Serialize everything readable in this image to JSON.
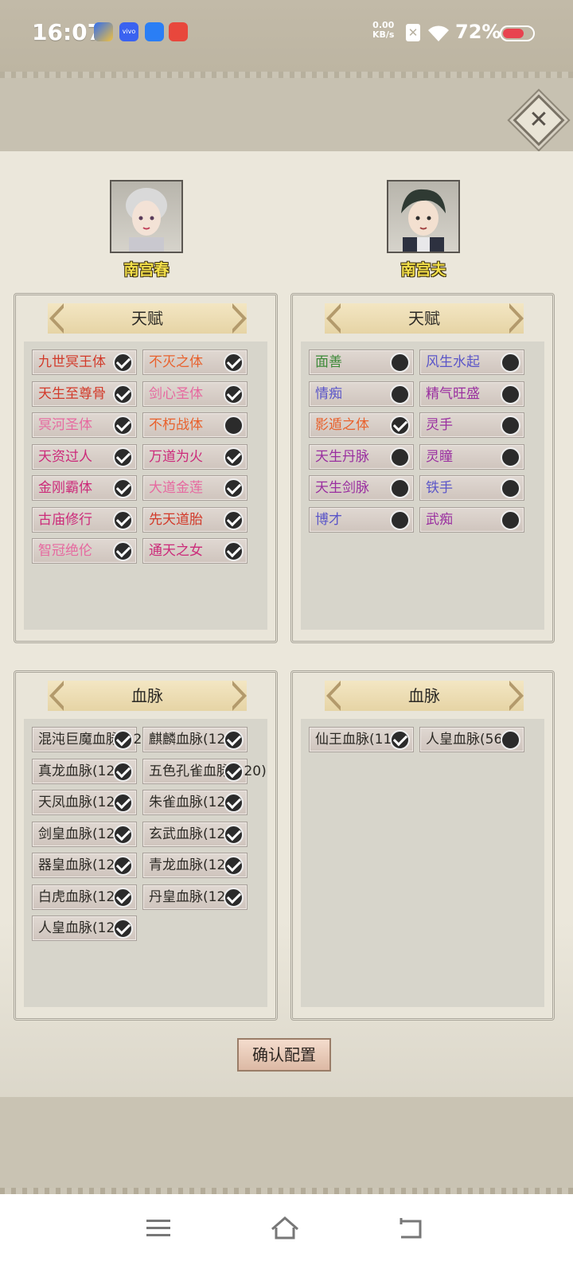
{
  "status_bar": {
    "time": "16:07",
    "net_speed": "0.00",
    "net_unit": "KB/s",
    "battery": "72%"
  },
  "close_label": "✕",
  "characters": [
    {
      "name": "南宫春"
    },
    {
      "name": "南宫夫"
    }
  ],
  "talent_title": "天赋",
  "bloodline_title": "血脉",
  "left_talents": [
    {
      "label": "九世冥王体",
      "color": "#d23a2a",
      "checked": true
    },
    {
      "label": "不灭之体",
      "color": "#e8622e",
      "checked": true
    },
    {
      "label": "天生至尊骨",
      "color": "#d23a2a",
      "checked": true
    },
    {
      "label": "剑心圣体",
      "color": "#e66aa0",
      "checked": true
    },
    {
      "label": "冥河圣体",
      "color": "#e66aa0",
      "checked": true
    },
    {
      "label": "不朽战体",
      "color": "#e8622e",
      "checked": false
    },
    {
      "label": "天资过人",
      "color": "#cc2b7a",
      "checked": true
    },
    {
      "label": "万道为火",
      "color": "#cc2b7a",
      "checked": true
    },
    {
      "label": "金刚霸体",
      "color": "#cc2b7a",
      "checked": true
    },
    {
      "label": "大道金莲",
      "color": "#e66aa0",
      "checked": true
    },
    {
      "label": "古庙修行",
      "color": "#cc2b7a",
      "checked": true
    },
    {
      "label": "先天道胎",
      "color": "#d23a2a",
      "checked": true
    },
    {
      "label": "智冠绝伦",
      "color": "#e66aa0",
      "checked": true
    },
    {
      "label": "通天之女",
      "color": "#cc2b7a",
      "checked": true
    }
  ],
  "right_talents": [
    {
      "label": "面善",
      "color": "#3f8a3a",
      "checked": false
    },
    {
      "label": "风生水起",
      "color": "#5b56c8",
      "checked": false
    },
    {
      "label": "情痴",
      "color": "#5b56c8",
      "checked": false
    },
    {
      "label": "精气旺盛",
      "color": "#9a2fa0",
      "checked": false
    },
    {
      "label": "影遁之体",
      "color": "#e8622e",
      "checked": true
    },
    {
      "label": "灵手",
      "color": "#9a2fa0",
      "checked": false
    },
    {
      "label": "天生丹脉",
      "color": "#9a2fa0",
      "checked": false
    },
    {
      "label": "灵瞳",
      "color": "#9a2fa0",
      "checked": false
    },
    {
      "label": "天生剑脉",
      "color": "#9a2fa0",
      "checked": false
    },
    {
      "label": "铁手",
      "color": "#5b56c8",
      "checked": false
    },
    {
      "label": "博才",
      "color": "#5b56c8",
      "checked": false
    },
    {
      "label": "武痴",
      "color": "#9a2fa0",
      "checked": false
    }
  ],
  "left_bloodlines": [
    {
      "label": "混沌巨魔血脉(12",
      "checked": true
    },
    {
      "label": "麒麟血脉(12",
      "checked": true
    },
    {
      "label": "真龙血脉(12",
      "checked": true
    },
    {
      "label": "五色孔雀血脉(120)",
      "checked": true
    },
    {
      "label": "天凤血脉(12",
      "checked": true
    },
    {
      "label": "朱雀血脉(12",
      "checked": true
    },
    {
      "label": "剑皇血脉(12",
      "checked": true
    },
    {
      "label": "玄武血脉(12",
      "checked": true
    },
    {
      "label": "器皇血脉(12",
      "checked": true
    },
    {
      "label": "青龙血脉(12",
      "checked": true
    },
    {
      "label": "白虎血脉(12",
      "checked": true
    },
    {
      "label": "丹皇血脉(12",
      "checked": true
    },
    {
      "label": "人皇血脉(12",
      "checked": true
    }
  ],
  "right_bloodlines": [
    {
      "label": "仙王血脉(11",
      "checked": true
    },
    {
      "label": "人皇血脉(56)",
      "checked": false
    }
  ],
  "confirm_label": "确认配置"
}
